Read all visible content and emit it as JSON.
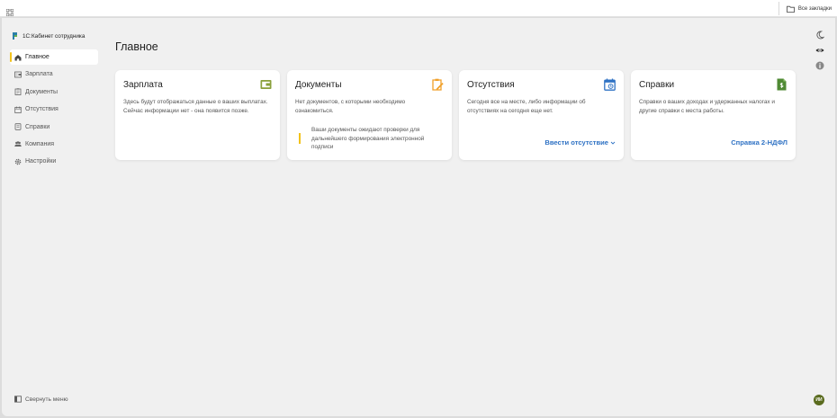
{
  "browser": {
    "all_bookmarks_label": "Все закладки"
  },
  "sidebar": {
    "brand": "1С:Кабинет сотрудника",
    "items": [
      {
        "label": "Главное",
        "icon": "home-icon",
        "active": true
      },
      {
        "label": "Зарплата",
        "icon": "salary-icon",
        "active": false
      },
      {
        "label": "Документы",
        "icon": "documents-icon",
        "active": false
      },
      {
        "label": "Отсутствия",
        "icon": "calendar-icon",
        "active": false
      },
      {
        "label": "Справки",
        "icon": "certificate-icon",
        "active": false
      },
      {
        "label": "Компания",
        "icon": "people-icon",
        "active": false
      },
      {
        "label": "Настройки",
        "icon": "gear-icon",
        "active": false
      }
    ],
    "collapse_label": "Свернуть меню"
  },
  "main": {
    "title": "Главное",
    "cards": [
      {
        "title": "Зарплата",
        "icon": "wallet-icon",
        "text": "Здесь будут отображаться данные о ваших выплатах. Сейчас информации нет - она появится позже."
      },
      {
        "title": "Документы",
        "icon": "clipboard-pen-icon",
        "text": "Нет документов, с которыми необходимо ознакомиться.",
        "note": "Ваши документы ожидают проверки для дальнейшего формирования электронной подписи"
      },
      {
        "title": "Отсутствия",
        "icon": "calendar-clock-icon",
        "text": "Сегодня все на месте, либо информации об отсутствиях на сегодня еще нет.",
        "link": "Ввести отсутствие"
      },
      {
        "title": "Справки",
        "icon": "document-dollar-icon",
        "text": "Справки о ваших доходах и удержанных налогах и другие справки с места работы.",
        "link": "Справка 2-НДФЛ"
      }
    ]
  },
  "user": {
    "initials": "ИИ"
  },
  "colors": {
    "accent": "#f2c21b",
    "link": "#2f72c4",
    "wallet_icon": "#8aa03c",
    "documents_icon": "#f0a02a",
    "absence_icon": "#2f72c4",
    "certificate_icon": "#4f8a34",
    "avatar": "#5a6b1e"
  }
}
